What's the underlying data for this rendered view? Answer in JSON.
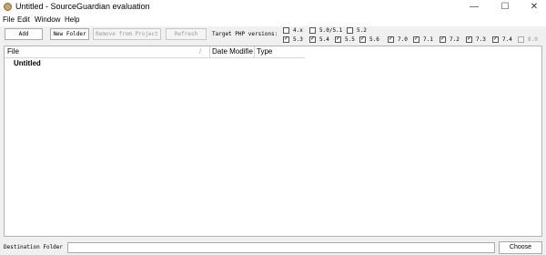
{
  "window": {
    "title": "Untitled - SourceGuardian evaluation",
    "minimize_glyph": "—",
    "maximize_glyph": "☐",
    "close_glyph": "✕"
  },
  "menu": {
    "items": [
      "File",
      "Edit",
      "Window",
      "Help"
    ]
  },
  "toolbar": {
    "add_label": "Add",
    "new_folder_label": "New Folder",
    "remove_label": "Remove from Project",
    "refresh_label": "Refresh",
    "php_versions_label": "Target PHP versions:",
    "php_versions": [
      {
        "label": "4.x",
        "checked": false,
        "disabled": false
      },
      {
        "label": "5.0/5.1",
        "checked": false,
        "disabled": false
      },
      {
        "label": "5.2",
        "checked": false,
        "disabled": false
      },
      {
        "label": "5.3",
        "checked": true,
        "disabled": false
      },
      {
        "label": "5.4",
        "checked": true,
        "disabled": false
      },
      {
        "label": "5.5",
        "checked": true,
        "disabled": false
      },
      {
        "label": "5.6",
        "checked": true,
        "disabled": false
      },
      {
        "label": "7.0",
        "checked": true,
        "disabled": false
      },
      {
        "label": "7.1",
        "checked": true,
        "disabled": false
      },
      {
        "label": "7.2",
        "checked": true,
        "disabled": false
      },
      {
        "label": "7.3",
        "checked": true,
        "disabled": false
      },
      {
        "label": "7.4",
        "checked": true,
        "disabled": false
      },
      {
        "label": "8.0",
        "checked": false,
        "disabled": true
      }
    ]
  },
  "file_list": {
    "columns": [
      "File",
      "Date Modifie",
      "Type"
    ],
    "rows": [
      "Untitled"
    ]
  },
  "bottom": {
    "destination_label": "Destination Folder",
    "destination_value": "",
    "choose_label": "Choose"
  }
}
